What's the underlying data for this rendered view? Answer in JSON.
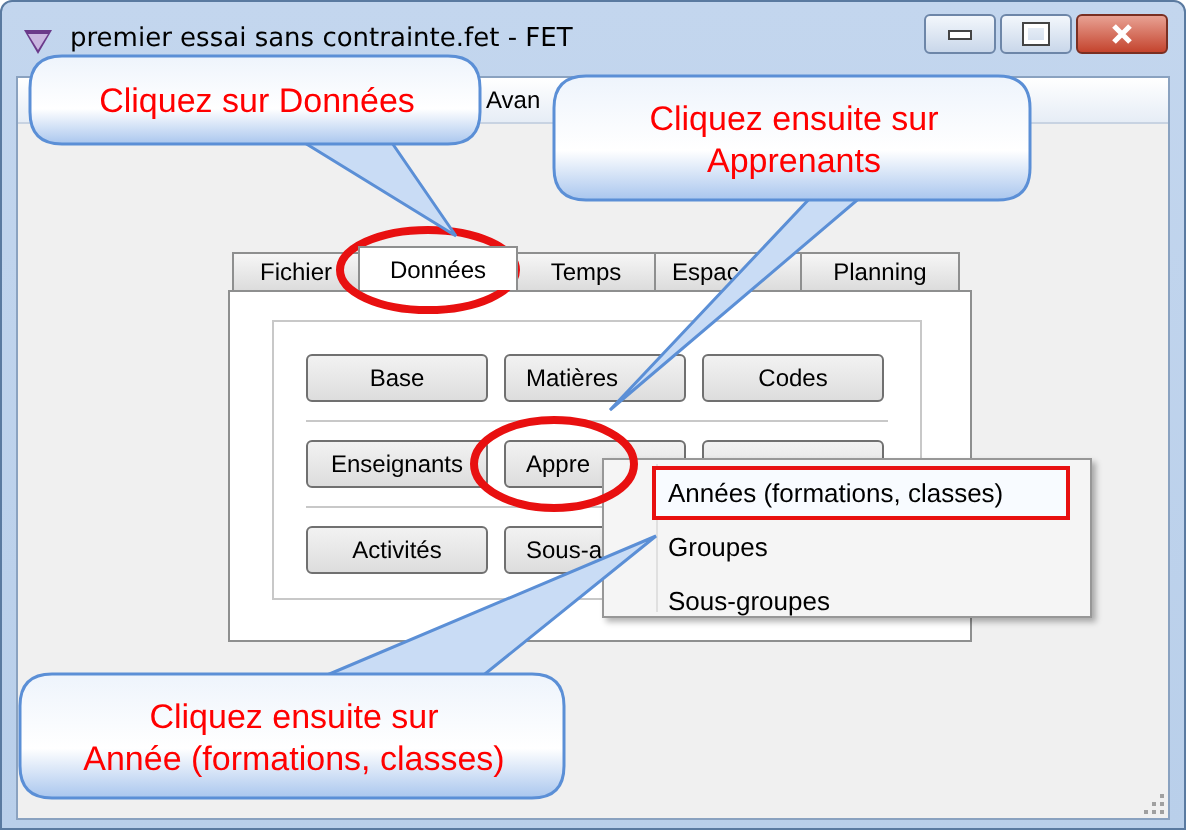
{
  "window": {
    "title": "premier essai sans contrainte.fet - FET"
  },
  "menu_bar": [
    {
      "label": "Avan"
    }
  ],
  "tabs": [
    {
      "label": "Fichier",
      "selected": false
    },
    {
      "label": "Données",
      "selected": true
    },
    {
      "label": "Temps",
      "selected": false
    },
    {
      "label": "Espac",
      "selected": false
    },
    {
      "label": "Planning",
      "selected": false
    }
  ],
  "button_rows": [
    [
      {
        "label": "Base",
        "kind": "full"
      },
      {
        "label": "Matières",
        "kind": "partial"
      },
      {
        "label": "Codes",
        "kind": "full"
      }
    ],
    [
      {
        "label": "Enseignants",
        "kind": "full"
      },
      {
        "label": "Appre",
        "kind": "partial"
      },
      {
        "kind": "full"
      }
    ],
    [
      {
        "label": "Activités",
        "kind": "full"
      },
      {
        "label": "Sous-a",
        "kind": "partial"
      }
    ]
  ],
  "popup_menu": {
    "items": [
      {
        "label": "Années (formations, classes)",
        "selected": true
      },
      {
        "label": "Groupes",
        "selected": false
      },
      {
        "label": "Sous-groupes",
        "selected": false
      }
    ]
  },
  "callouts": [
    {
      "lines": [
        "Cliquez sur Données"
      ]
    },
    {
      "lines": [
        "Cliquez ensuite sur",
        "Apprenants"
      ]
    },
    {
      "lines": [
        "Cliquez ensuite sur",
        "Année (formations, classes)"
      ]
    }
  ]
}
